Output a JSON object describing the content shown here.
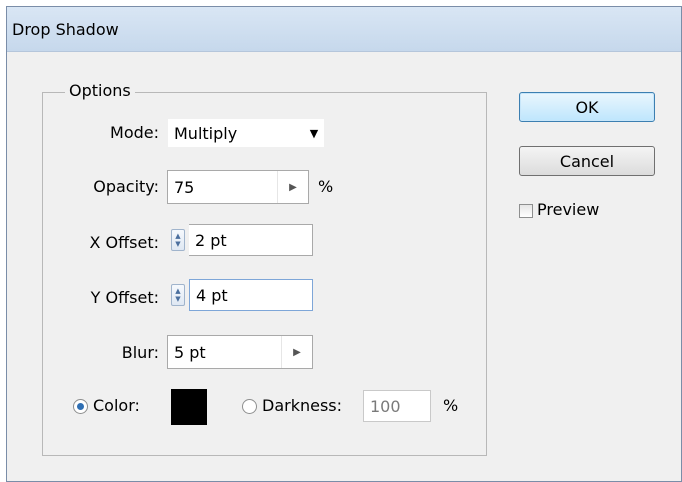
{
  "window": {
    "title": "Drop Shadow"
  },
  "options": {
    "legend": "Options",
    "mode": {
      "label": "Mode:",
      "value": "Multiply"
    },
    "opacity": {
      "label": "Opacity:",
      "value": "75",
      "unit": "%"
    },
    "x_offset": {
      "label": "X Offset:",
      "value": "2 pt"
    },
    "y_offset": {
      "label": "Y Offset:",
      "value": "4 pt"
    },
    "blur": {
      "label": "Blur:",
      "value": "5 pt"
    },
    "color": {
      "label": "Color:",
      "selected": true,
      "swatch": "#000000"
    },
    "darkness": {
      "label": "Darkness:",
      "value": "100",
      "unit": "%",
      "selected": false
    }
  },
  "buttons": {
    "ok": "OK",
    "cancel": "Cancel"
  },
  "preview": {
    "label": "Preview",
    "checked": false
  }
}
